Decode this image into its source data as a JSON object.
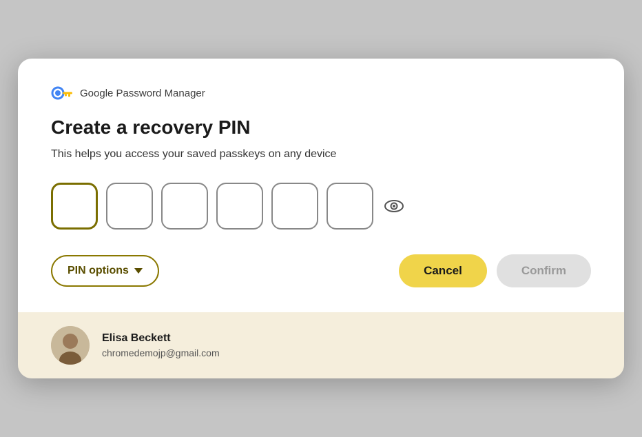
{
  "header": {
    "app_name": "Google Password Manager"
  },
  "dialog": {
    "heading": "Create a recovery PIN",
    "subtitle": "This helps you access your saved passkeys on any device",
    "pin_placeholder": "",
    "pin_count": 6
  },
  "buttons": {
    "pin_options_label": "PIN options",
    "cancel_label": "Cancel",
    "confirm_label": "Confirm"
  },
  "footer": {
    "user_name": "Elisa Beckett",
    "user_email": "chromedemojp@gmail.com"
  },
  "colors": {
    "pin_options_border": "#8a7800",
    "pin_options_text": "#5a4e00",
    "cancel_bg": "#f0d44a",
    "confirm_bg": "#e0e0e0",
    "confirm_text": "#999999",
    "footer_bg": "#f5eedc"
  },
  "icons": {
    "eye": "👁",
    "chevron_down": "▾"
  }
}
